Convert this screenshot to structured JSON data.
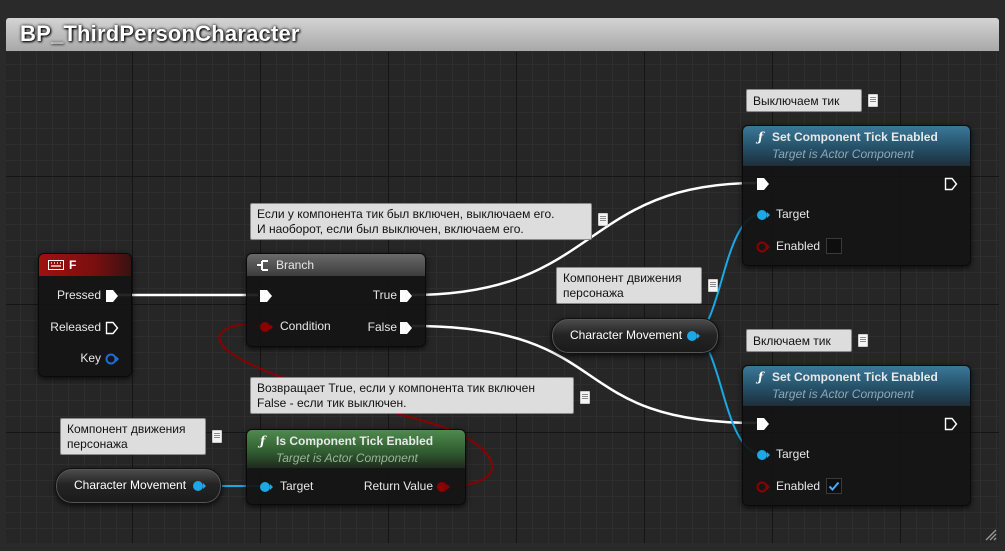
{
  "window": {
    "title": "BP_ThirdPersonCharacter"
  },
  "colors": {
    "exec": "#ffffff",
    "object_pin": "#1aa8e6",
    "bool_pin": "#8b0000",
    "call_header": "#2f6a8a",
    "pure_header": "#3a6b3a",
    "event_header": "#8c1212"
  },
  "nodes": {
    "event_f": {
      "title": "F",
      "icon": "keyboard-icon",
      "pins": {
        "pressed": "Pressed",
        "released": "Released",
        "key": "Key"
      }
    },
    "branch": {
      "title": "Branch",
      "icon": "branch-icon",
      "pins": {
        "condition": "Condition",
        "true": "True",
        "false": "False"
      }
    },
    "set_tick_top": {
      "title": "Set Component Tick Enabled",
      "subtitle": "Target is Actor Component",
      "icon": "function-icon",
      "pins": {
        "target": "Target",
        "enabled": "Enabled"
      },
      "enabled_checked": false
    },
    "set_tick_bottom": {
      "title": "Set Component Tick Enabled",
      "subtitle": "Target is Actor Component",
      "icon": "function-icon",
      "pins": {
        "target": "Target",
        "enabled": "Enabled"
      },
      "enabled_checked": true
    },
    "is_tick_enabled": {
      "title": "Is Component Tick Enabled",
      "subtitle": "Target is Actor Component",
      "icon": "function-icon",
      "pins": {
        "target": "Target",
        "return": "Return Value"
      }
    },
    "char_move_right": {
      "label": "Character Movement"
    },
    "char_move_left": {
      "label": "Character Movement"
    }
  },
  "comments": {
    "branch": {
      "line1": "Если у компонента тик был включен, выключаем его.",
      "line2": "И наоборот, если был выключен, включаем его."
    },
    "set_top": {
      "line1": "Выключаем тик"
    },
    "set_bottom": {
      "line1": "Включаем тик"
    },
    "char_move_right": {
      "line1": "Компонент движения",
      "line2": "персонажа"
    },
    "char_move_left": {
      "line1": "Компонент движения",
      "line2": "персонажа"
    },
    "is_tick": {
      "line1": "Возвращает True, если у компонента тик включен",
      "line2": "False - если тик выключен."
    }
  }
}
